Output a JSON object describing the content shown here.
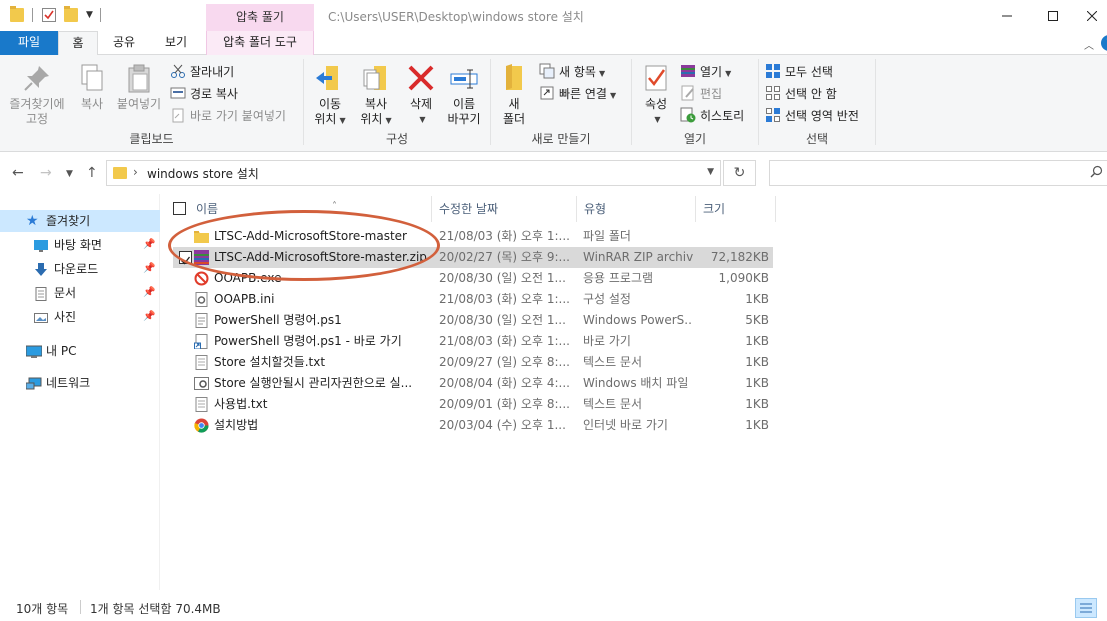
{
  "window": {
    "title_path": "C:\\Users\\USER\\Desktop\\windows store 설치",
    "context_tab_header": "압축 풀기"
  },
  "ribbon_tabs": [
    "파일",
    "홈",
    "공유",
    "보기",
    "압축 폴더 도구"
  ],
  "ribbon": {
    "clipboard": {
      "pin_label_1": "즐겨찾기에",
      "pin_label_2": "고정",
      "copy": "복사",
      "paste": "붙여넣기",
      "cut": "잘라내기",
      "copy_path": "경로 복사",
      "paste_shortcut": "바로 가기 붙여넣기",
      "group": "클립보드"
    },
    "organize": {
      "move_1": "이동",
      "move_2": "위치",
      "copy_to_1": "복사",
      "copy_to_2": "위치",
      "delete": "삭제",
      "rename_1": "이름",
      "rename_2": "바꾸기",
      "group": "구성"
    },
    "new": {
      "new_folder_1": "새",
      "new_folder_2": "폴더",
      "new_item": "새 항목",
      "easy_access": "빠른 연결",
      "group": "새로 만들기"
    },
    "open": {
      "properties": "속성",
      "open": "열기",
      "edit": "편집",
      "history": "히스토리",
      "group": "열기"
    },
    "select": {
      "select_all": "모두 선택",
      "select_none": "선택 안 함",
      "invert": "선택 영역 반전",
      "group": "선택"
    }
  },
  "address": {
    "path": "windows store 설치",
    "search_placeholder": ""
  },
  "nav": {
    "quick_access": "즐겨찾기",
    "desktop": "바탕 화면",
    "downloads": "다운로드",
    "documents": "문서",
    "pictures": "사진",
    "this_pc": "내 PC",
    "network": "네트워크"
  },
  "columns": {
    "name": "이름",
    "date": "수정한 날짜",
    "type": "유형",
    "size": "크기"
  },
  "files": [
    {
      "name": "LTSC-Add-MicrosoftStore-master",
      "date": "21/08/03 (화) 오후 1:...",
      "type": "파일 폴더",
      "size": "",
      "icon": "folder-icon"
    },
    {
      "name": "LTSC-Add-MicrosoftStore-master.zip",
      "date": "20/02/27 (목) 오후 9:...",
      "type": "WinRAR ZIP archive",
      "size": "72,182KB",
      "icon": "winrar-archive-icon"
    },
    {
      "name": "OOAPB.exe",
      "date": "20/08/30 (일) 오전 1...",
      "type": "응용 프로그램",
      "size": "1,090KB",
      "icon": "no-entry-app-icon"
    },
    {
      "name": "OOAPB.ini",
      "date": "21/08/03 (화) 오후 1:...",
      "type": "구성 설정",
      "size": "1KB",
      "icon": "settings-file-icon"
    },
    {
      "name": "PowerShell 명령어.ps1",
      "date": "20/08/30 (일) 오전 1...",
      "type": "Windows PowerS...",
      "size": "5KB",
      "icon": "script-file-icon"
    },
    {
      "name": "PowerShell 명령어.ps1 - 바로 가기",
      "date": "21/08/03 (화) 오후 1:...",
      "type": "바로 가기",
      "size": "1KB",
      "icon": "shortcut-file-icon"
    },
    {
      "name": "Store 설치할것들.txt",
      "date": "20/09/27 (일) 오후 8:...",
      "type": "텍스트 문서",
      "size": "1KB",
      "icon": "text-file-icon"
    },
    {
      "name": "Store 실행안될시 관리자권한으로 실...",
      "date": "20/08/04 (화) 오후 4:...",
      "type": "Windows 배치 파일",
      "size": "1KB",
      "icon": "batch-file-icon"
    },
    {
      "name": "사용법.txt",
      "date": "20/09/01 (화) 오후 8:...",
      "type": "텍스트 문서",
      "size": "1KB",
      "icon": "text-file-icon"
    },
    {
      "name": "설치방법",
      "date": "20/03/04 (수) 오후 1...",
      "type": "인터넷 바로 가기",
      "size": "1KB",
      "icon": "chrome-shortcut-icon"
    }
  ],
  "status": {
    "count": "10개 항목",
    "selection": "1개 항목 선택함 70.4MB"
  },
  "colors": {
    "file_tab": "#1979ca",
    "context_tab": "#f8d9ef",
    "selection": "#cce8ff",
    "annotation_oval": "#d2603c"
  }
}
